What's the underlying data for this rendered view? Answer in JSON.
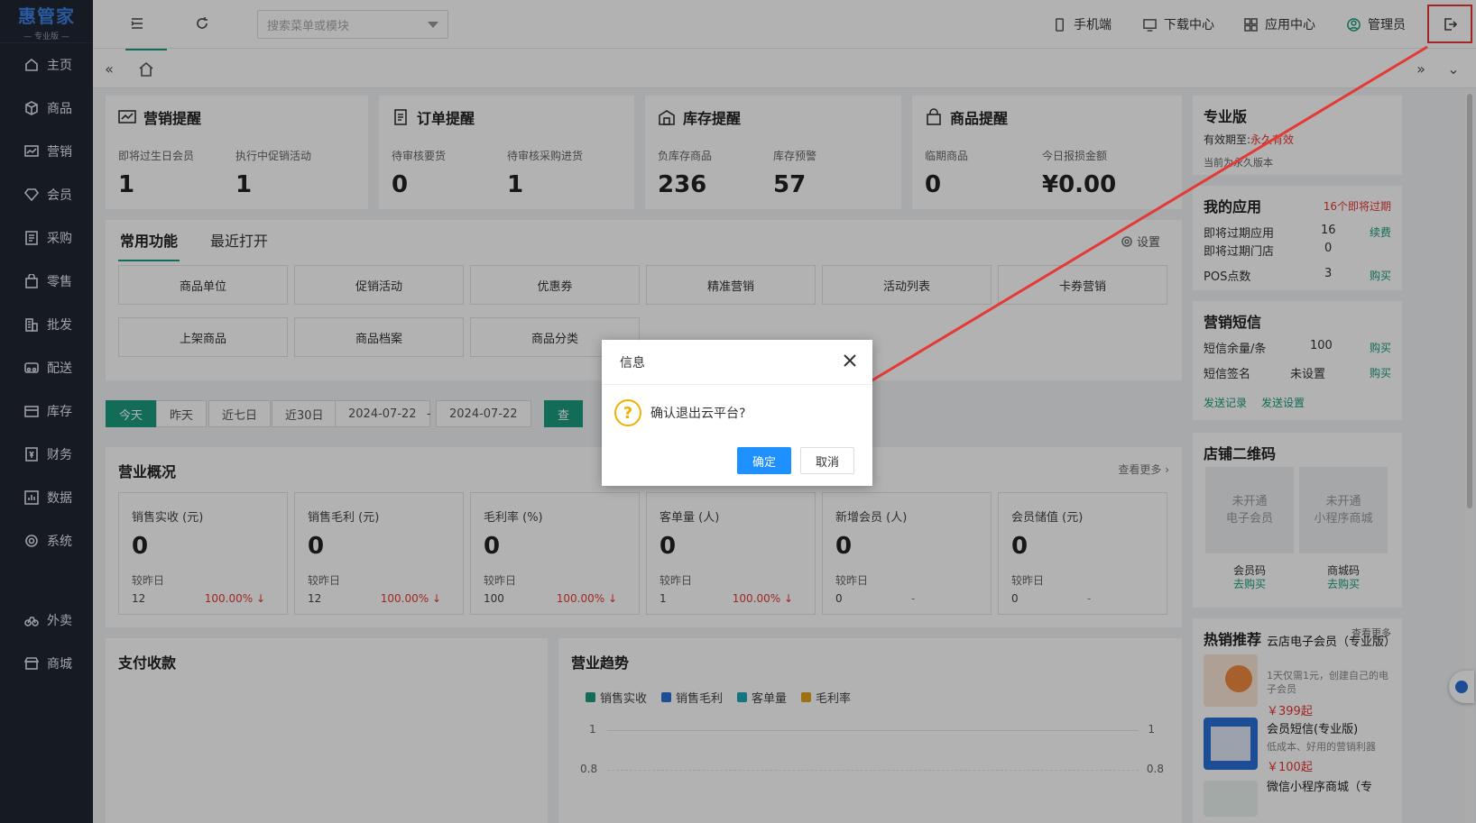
{
  "logo": {
    "main": "惠管家",
    "sub": "— 专业版 —"
  },
  "sidebar": {
    "items": [
      {
        "label": "主页",
        "icon": "home-icon"
      },
      {
        "label": "商品",
        "icon": "box-icon"
      },
      {
        "label": "营销",
        "icon": "chart-icon"
      },
      {
        "label": "会员",
        "icon": "diamond-icon"
      },
      {
        "label": "采购",
        "icon": "list-icon"
      },
      {
        "label": "零售",
        "icon": "bag-icon"
      },
      {
        "label": "批发",
        "icon": "building-icon"
      },
      {
        "label": "配送",
        "icon": "truck-icon"
      },
      {
        "label": "库存",
        "icon": "warehouse-icon"
      },
      {
        "label": "财务",
        "icon": "finance-icon"
      },
      {
        "label": "数据",
        "icon": "data-icon"
      },
      {
        "label": "系统",
        "icon": "gear-icon"
      },
      {
        "label": "外卖",
        "icon": "bike-icon"
      },
      {
        "label": "商城",
        "icon": "store-icon"
      }
    ]
  },
  "topbar": {
    "search_placeholder": "搜索菜单或模块",
    "mobile": "手机端",
    "download": "下载中心",
    "apps": "应用中心",
    "user": "管理员"
  },
  "alerts": [
    {
      "title": "营销提醒",
      "icon": "chart-icon",
      "labels": [
        "即将过生日会员",
        "执行中促销活动"
      ],
      "values": [
        "1",
        "1"
      ]
    },
    {
      "title": "订单提醒",
      "icon": "clipboard-icon",
      "labels": [
        "待审核要货",
        "待审核采购进货"
      ],
      "values": [
        "0",
        "1"
      ]
    },
    {
      "title": "库存提醒",
      "icon": "warehouse-icon",
      "labels": [
        "负库存商品",
        "库存预警"
      ],
      "values": [
        "236",
        "57"
      ]
    },
    {
      "title": "商品提醒",
      "icon": "bag-icon",
      "labels": [
        "临期商品",
        "今日报损金额"
      ],
      "values": [
        "0",
        "¥0.00"
      ]
    }
  ],
  "functions": {
    "tabs": [
      "常用功能",
      "最近打开"
    ],
    "setting": "设置",
    "buttons": [
      "商品单位",
      "促销活动",
      "优惠券",
      "精准营销",
      "活动列表",
      "卡券营销",
      "上架商品",
      "商品档案",
      "商品分类"
    ]
  },
  "dates": {
    "buttons": [
      "今天",
      "昨天",
      "近七日",
      "近30日"
    ],
    "start": "2024-07-22",
    "sep": "-",
    "end": "2024-07-22",
    "query": "查"
  },
  "business": {
    "title": "营业概况",
    "more": "查看更多 ›",
    "compare_label": "较昨日",
    "metrics": [
      {
        "title": "销售实收 (元)",
        "value": "0",
        "prev": "12",
        "rate": "100.00% ↓"
      },
      {
        "title": "销售毛利 (元)",
        "value": "0",
        "prev": "12",
        "rate": "100.00% ↓"
      },
      {
        "title": "毛利率 (%)",
        "value": "0",
        "prev": "100",
        "rate": "100.00% ↓"
      },
      {
        "title": "客单量 (人)",
        "value": "0",
        "prev": "1",
        "rate": "100.00% ↓"
      },
      {
        "title": "新增会员 (人)",
        "value": "0",
        "prev": "0",
        "rate": "-"
      },
      {
        "title": "会员储值 (元)",
        "value": "0",
        "prev": "0",
        "rate": "-"
      }
    ]
  },
  "payment": {
    "title": "支付收款"
  },
  "trend": {
    "title": "营业趋势",
    "legend": [
      {
        "name": "销售实收",
        "color": "#1a9b7d"
      },
      {
        "name": "销售毛利",
        "color": "#2a6fd6"
      },
      {
        "name": "客单量",
        "color": "#1fa8b5"
      },
      {
        "name": "毛利率",
        "color": "#e0a31c"
      }
    ],
    "y_labels": [
      "1",
      "0.8"
    ]
  },
  "pro": {
    "title": "专业版",
    "expiry_label": "有效期至:",
    "expiry_value": "永久有效",
    "note": "当前为永久版本"
  },
  "my_apps": {
    "title": "我的应用",
    "alert": "16个即将过期",
    "rows": [
      {
        "label": "即将过期应用",
        "value": "16",
        "action": "续费"
      },
      {
        "label": "即将过期门店",
        "value": "0",
        "action": ""
      },
      {
        "label": "POS点数",
        "value": "3",
        "action": "购买"
      }
    ]
  },
  "sms": {
    "title": "营销短信",
    "rows": [
      {
        "label": "短信余量/条",
        "value": "100",
        "action": "购买"
      },
      {
        "label": "短信签名",
        "value": "未设置",
        "action": "购买"
      }
    ],
    "links": [
      "发送记录",
      "发送设置"
    ]
  },
  "qr": {
    "title": "店铺二维码",
    "boxes": [
      {
        "l1": "未开通",
        "l2": "电子会员",
        "name": "会员码",
        "action": "去购买"
      },
      {
        "l1": "未开通",
        "l2": "小程序商城",
        "name": "商城码",
        "action": "去购买"
      }
    ]
  },
  "hot": {
    "title": "热销推荐",
    "more": "查看更多",
    "items": [
      {
        "name": "云店电子会员（专业版）",
        "desc": "1天仅需1元，创建自己的电子会员",
        "price": "￥399起"
      },
      {
        "name": "会员短信(专业版)",
        "desc": "低成本、好用的营销利器",
        "price": "￥100起"
      },
      {
        "name": "微信小程序商城（专",
        "desc": "",
        "price": ""
      }
    ]
  },
  "dialog": {
    "title": "信息",
    "message": "确认退出云平台?",
    "ok": "确定",
    "cancel": "取消"
  },
  "colors": {
    "accent": "#1a9b7d",
    "primary": "#1e90ff",
    "sidebar": "#1f2633",
    "alert_red": "#e53935"
  }
}
